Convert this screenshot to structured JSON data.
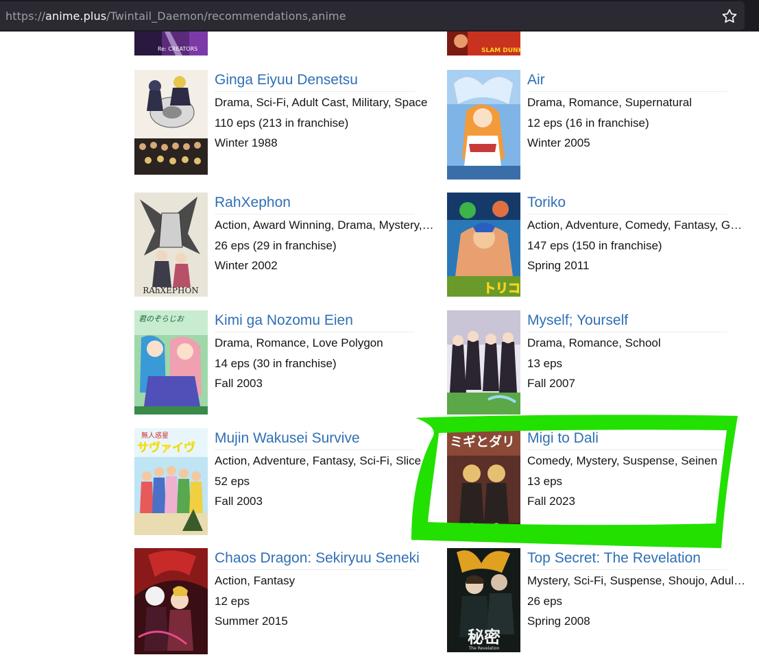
{
  "browser": {
    "url_protocol": "https://",
    "url_host": "anime.plus",
    "url_path": "/Twintail_Daemon/recommendations,anime",
    "bookmark_icon": "star-icon"
  },
  "partial_posters": {
    "left_caption": "Re: CREATORS",
    "right_caption": "SLAM DUNK"
  },
  "recommendations": [
    {
      "title": "Ginga Eiyuu Densetsu",
      "genres": "Drama, Sci-Fi, Adult Cast, Military, Space",
      "episodes": "110 eps (213 in franchise)",
      "season": "Winter 1988"
    },
    {
      "title": "Air",
      "genres": "Drama, Romance, Supernatural",
      "episodes": "12 eps (16 in franchise)",
      "season": "Winter 2005"
    },
    {
      "title": "RahXephon",
      "genres": "Action, Award Winning, Drama, Mystery, Sci-Fi",
      "episodes": "26 eps (29 in franchise)",
      "season": "Winter 2002",
      "poster_text": "RAhXEPHON"
    },
    {
      "title": "Toriko",
      "genres": "Action, Adventure, Comedy, Fantasy, Gourmet",
      "episodes": "147 eps (150 in franchise)",
      "season": "Spring 2011",
      "poster_text": "トリコ"
    },
    {
      "title": "Kimi ga Nozomu Eien",
      "genres": "Drama, Romance, Love Polygon",
      "episodes": "14 eps (30 in franchise)",
      "season": "Fall 2003",
      "poster_text": "君のぞらじお"
    },
    {
      "title": "Myself; Yourself",
      "genres": "Drama, Romance, School",
      "episodes": "13 eps",
      "season": "Fall 2007"
    },
    {
      "title": "Mujin Wakusei Survive",
      "genres": "Action, Adventure, Fantasy, Sci-Fi, Slice of Life",
      "episodes": "52 eps",
      "season": "Fall 2003",
      "poster_text": "サヴァイヴ",
      "poster_subtext": "無人惑星"
    },
    {
      "title": "Migi to Dali",
      "genres": "Comedy, Mystery, Suspense, Seinen",
      "episodes": "13 eps",
      "season": "Fall 2023",
      "poster_text": "ミギとダリ"
    },
    {
      "title": "Chaos Dragon: Sekiryuu Seneki",
      "genres": "Action, Fantasy",
      "episodes": "12 eps",
      "season": "Summer 2015"
    },
    {
      "title": "Top Secret: The Revelation",
      "genres": "Mystery, Sci-Fi, Suspense, Shoujo, Adult Cast",
      "episodes": "26 eps",
      "season": "Spring 2008",
      "poster_text": "秘密",
      "poster_subtext": "The Revelation"
    }
  ],
  "annotation": {
    "color": "#22e000"
  }
}
